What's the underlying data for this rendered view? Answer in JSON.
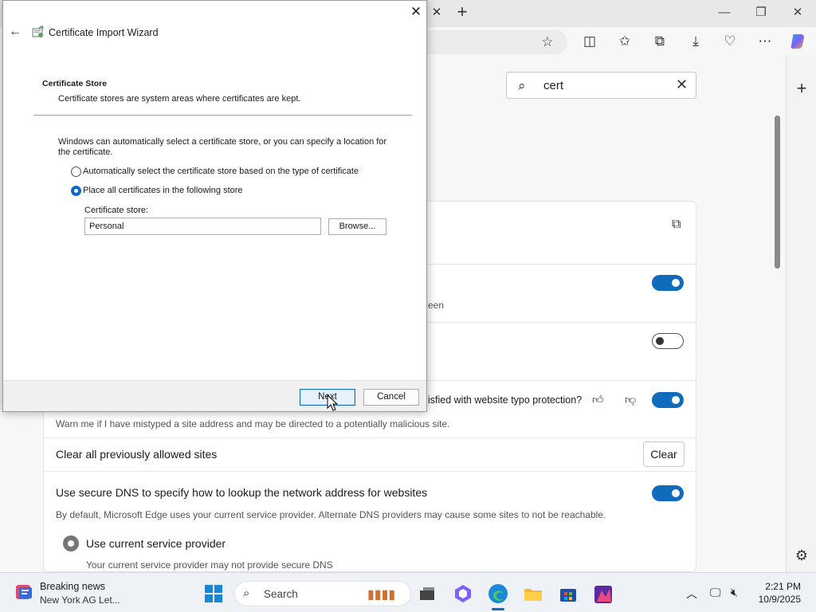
{
  "browser": {
    "search": {
      "value": "cert"
    },
    "settings": {
      "partial_row_text": "een",
      "typo_question": "isfied with website typo protection?",
      "typo_description": "Warn me if I have mistyped a site address and may be directed to a potentially malicious site.",
      "clear_sites_label": "Clear all previously allowed sites",
      "clear_button": "Clear",
      "dns_title": "Use secure DNS to specify how to lookup the network address for websites",
      "dns_description": "By default, Microsoft Edge uses your current service provider. Alternate DNS providers may cause some sites to not be reachable.",
      "dns_option_label": "Use current service provider",
      "dns_option_description": "Your current service provider may not provide secure DNS",
      "toggles": [
        true,
        false,
        true,
        true
      ]
    }
  },
  "dialog": {
    "title": "Certificate Import Wizard",
    "heading": "Certificate Store",
    "subheading": "Certificate stores are system areas where certificates are kept.",
    "description": "Windows can automatically select a certificate store, or you can specify a location for the certificate.",
    "option_auto": "Automatically select the certificate store based on the type of certificate",
    "option_manual": "Place all certificates in the following store",
    "selected_option": "manual",
    "store_label": "Certificate store:",
    "store_value": "Personal",
    "browse_button": "Browse...",
    "next_button": "Next",
    "cancel_button": "Cancel"
  },
  "taskbar": {
    "news_title": "Breaking news",
    "news_subtitle": "New York AG Let...",
    "search_label": "Search",
    "time": "2:21 PM",
    "date": "10/9/2025"
  },
  "colors": {
    "accent": "#0f6cbd"
  }
}
